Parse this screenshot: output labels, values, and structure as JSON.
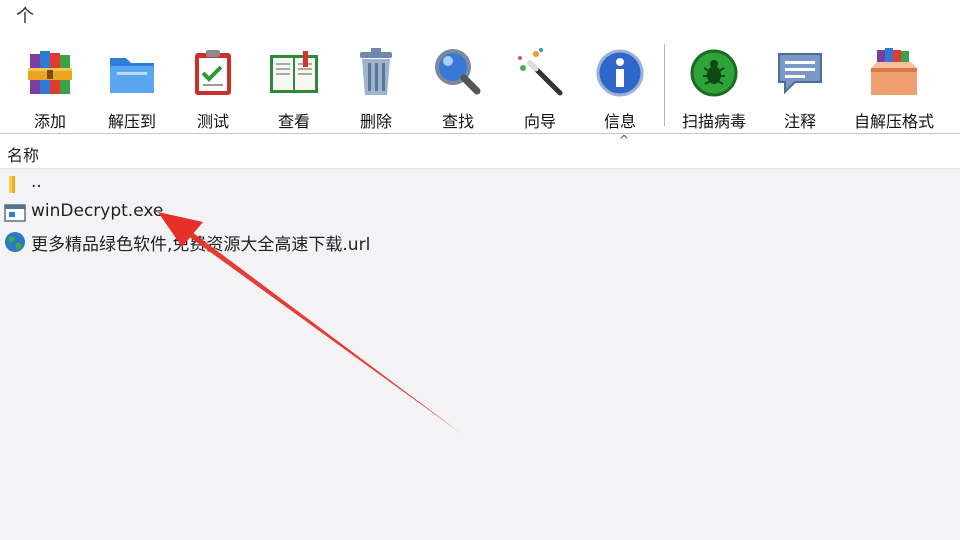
{
  "nav": {
    "up_glyph": "个"
  },
  "toolbar": {
    "items": [
      {
        "label": "添加",
        "icon": "winrar-books-icon"
      },
      {
        "label": "解压到",
        "icon": "folder-extract-icon"
      },
      {
        "label": "测试",
        "icon": "clipboard-check-icon"
      },
      {
        "label": "查看",
        "icon": "open-book-icon"
      },
      {
        "label": "删除",
        "icon": "trash-can-icon"
      },
      {
        "label": "查找",
        "icon": "magnifier-icon"
      },
      {
        "label": "向导",
        "icon": "magic-wand-icon"
      },
      {
        "label": "信息",
        "icon": "info-icon"
      },
      {
        "label": "扫描病毒",
        "icon": "virus-scan-icon"
      },
      {
        "label": "注释",
        "icon": "comment-bubble-icon"
      },
      {
        "label": "自解压格式",
        "icon": "sfx-box-icon"
      }
    ]
  },
  "list": {
    "column_name": "名称",
    "sort_glyph": "^",
    "files": [
      {
        "name": "..",
        "icon": "folder-icon"
      },
      {
        "name": "winDecrypt.exe",
        "icon": "exe-icon"
      },
      {
        "name": "更多精品绿色软件,免费资源大全高速下载.url",
        "icon": "globe-icon"
      }
    ]
  },
  "colors": {
    "annotation_arrow": "#e8302a",
    "background": "#f3f3f5"
  }
}
